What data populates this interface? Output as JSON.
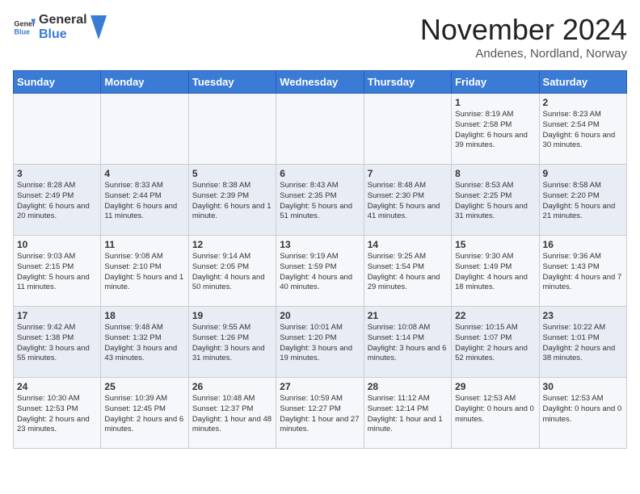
{
  "logo": {
    "text_general": "General",
    "text_blue": "Blue"
  },
  "title": "November 2024",
  "subtitle": "Andenes, Nordland, Norway",
  "days_of_week": [
    "Sunday",
    "Monday",
    "Tuesday",
    "Wednesday",
    "Thursday",
    "Friday",
    "Saturday"
  ],
  "weeks": [
    [
      {
        "day": "",
        "info": ""
      },
      {
        "day": "",
        "info": ""
      },
      {
        "day": "",
        "info": ""
      },
      {
        "day": "",
        "info": ""
      },
      {
        "day": "",
        "info": ""
      },
      {
        "day": "1",
        "info": "Sunrise: 8:19 AM\nSunset: 2:58 PM\nDaylight: 6 hours and 39 minutes."
      },
      {
        "day": "2",
        "info": "Sunrise: 8:23 AM\nSunset: 2:54 PM\nDaylight: 6 hours and 30 minutes."
      }
    ],
    [
      {
        "day": "3",
        "info": "Sunrise: 8:28 AM\nSunset: 2:49 PM\nDaylight: 6 hours and 20 minutes."
      },
      {
        "day": "4",
        "info": "Sunrise: 8:33 AM\nSunset: 2:44 PM\nDaylight: 6 hours and 11 minutes."
      },
      {
        "day": "5",
        "info": "Sunrise: 8:38 AM\nSunset: 2:39 PM\nDaylight: 6 hours and 1 minute."
      },
      {
        "day": "6",
        "info": "Sunrise: 8:43 AM\nSunset: 2:35 PM\nDaylight: 5 hours and 51 minutes."
      },
      {
        "day": "7",
        "info": "Sunrise: 8:48 AM\nSunset: 2:30 PM\nDaylight: 5 hours and 41 minutes."
      },
      {
        "day": "8",
        "info": "Sunrise: 8:53 AM\nSunset: 2:25 PM\nDaylight: 5 hours and 31 minutes."
      },
      {
        "day": "9",
        "info": "Sunrise: 8:58 AM\nSunset: 2:20 PM\nDaylight: 5 hours and 21 minutes."
      }
    ],
    [
      {
        "day": "10",
        "info": "Sunrise: 9:03 AM\nSunset: 2:15 PM\nDaylight: 5 hours and 11 minutes."
      },
      {
        "day": "11",
        "info": "Sunrise: 9:08 AM\nSunset: 2:10 PM\nDaylight: 5 hours and 1 minute."
      },
      {
        "day": "12",
        "info": "Sunrise: 9:14 AM\nSunset: 2:05 PM\nDaylight: 4 hours and 50 minutes."
      },
      {
        "day": "13",
        "info": "Sunrise: 9:19 AM\nSunset: 1:59 PM\nDaylight: 4 hours and 40 minutes."
      },
      {
        "day": "14",
        "info": "Sunrise: 9:25 AM\nSunset: 1:54 PM\nDaylight: 4 hours and 29 minutes."
      },
      {
        "day": "15",
        "info": "Sunrise: 9:30 AM\nSunset: 1:49 PM\nDaylight: 4 hours and 18 minutes."
      },
      {
        "day": "16",
        "info": "Sunrise: 9:36 AM\nSunset: 1:43 PM\nDaylight: 4 hours and 7 minutes."
      }
    ],
    [
      {
        "day": "17",
        "info": "Sunrise: 9:42 AM\nSunset: 1:38 PM\nDaylight: 3 hours and 55 minutes."
      },
      {
        "day": "18",
        "info": "Sunrise: 9:48 AM\nSunset: 1:32 PM\nDaylight: 3 hours and 43 minutes."
      },
      {
        "day": "19",
        "info": "Sunrise: 9:55 AM\nSunset: 1:26 PM\nDaylight: 3 hours and 31 minutes."
      },
      {
        "day": "20",
        "info": "Sunrise: 10:01 AM\nSunset: 1:20 PM\nDaylight: 3 hours and 19 minutes."
      },
      {
        "day": "21",
        "info": "Sunrise: 10:08 AM\nSunset: 1:14 PM\nDaylight: 3 hours and 6 minutes."
      },
      {
        "day": "22",
        "info": "Sunrise: 10:15 AM\nSunset: 1:07 PM\nDaylight: 2 hours and 52 minutes."
      },
      {
        "day": "23",
        "info": "Sunrise: 10:22 AM\nSunset: 1:01 PM\nDaylight: 2 hours and 38 minutes."
      }
    ],
    [
      {
        "day": "24",
        "info": "Sunrise: 10:30 AM\nSunset: 12:53 PM\nDaylight: 2 hours and 23 minutes."
      },
      {
        "day": "25",
        "info": "Sunrise: 10:39 AM\nSunset: 12:45 PM\nDaylight: 2 hours and 6 minutes."
      },
      {
        "day": "26",
        "info": "Sunrise: 10:48 AM\nSunset: 12:37 PM\nDaylight: 1 hour and 48 minutes."
      },
      {
        "day": "27",
        "info": "Sunrise: 10:59 AM\nSunset: 12:27 PM\nDaylight: 1 hour and 27 minutes."
      },
      {
        "day": "28",
        "info": "Sunrise: 11:12 AM\nSunset: 12:14 PM\nDaylight: 1 hour and 1 minute."
      },
      {
        "day": "29",
        "info": "Sunset: 12:53 AM\nDaylight: 0 hours and 0 minutes."
      },
      {
        "day": "30",
        "info": "Sunset: 12:53 AM\nDaylight: 0 hours and 0 minutes."
      }
    ]
  ]
}
